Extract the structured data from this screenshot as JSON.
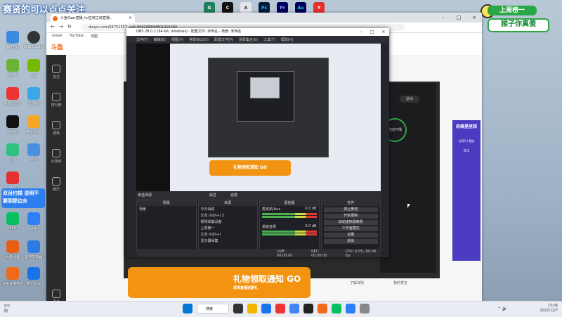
{
  "desktop": {
    "banner_top": "赛贤的可以点点关注",
    "left_badge": "双目扫描 说明不要到那边去",
    "icons": [
      "腾讯QQ",
      "OBS Studio",
      "NVIDIA",
      "火绒",
      "网易云音乐",
      "QQ游戏",
      "QQ音乐",
      "腾讯视频",
      "迅雷",
      "WPS",
      "微信",
      "斗鱼",
      "360",
      "百度网盘",
      "雷神加速器",
      "斗鱼直播伴侣",
      "腾讯会议",
      "QQ浏览器"
    ]
  },
  "corner_badge": {
    "line1": "上周榜一",
    "line2": "猴子你真傻"
  },
  "browser": {
    "tab_title": "斗鱼Ozar直播_lol正统之房直播...",
    "url": "douyu.com/64751357_yuft-906208894801416260",
    "bookmarks": [
      "Gmail",
      "YouTube",
      "地图"
    ],
    "douyu_logo": "斗鱼",
    "leftbar": [
      "关注",
      "排行榜",
      "游戏",
      "云游戏",
      "娱乐",
      "看鱼",
      "更多"
    ],
    "bottom_ad": "礼物领取通知 GO",
    "bottom_ad_sub": "周周直播送豪礼",
    "right_label_1": "我的发言",
    "right_label_2": "了解详情",
    "right_panel_button": "退出",
    "right_panel_circle": "自动开播",
    "side_ad_title": "奇缘星座馆",
    "side_ad_text": "点亮1个星座",
    "side_ad_count": "0/1"
  },
  "obs": {
    "title": "OBS 28.0.2 (64-bit, windows) - 配置文件: 未命名 - 场景: 未命名",
    "menu": [
      "文件(F)",
      "编辑(E)",
      "视图(V)",
      "停靠窗口(D)",
      "配置文件(P)",
      "场景集合(S)",
      "工具(T)",
      "帮助(H)"
    ],
    "source_bar_label": "未选择源",
    "source_bar_props": "属性",
    "source_bar_filter": "滤镜",
    "scenes_title": "场景",
    "scenes": [
      "场景"
    ],
    "sources_title": "来源",
    "sources": [
      "今日战绩",
      "文本 (GDI+) 2",
      "视频采集设备",
      "上周榜一",
      "文本 (GDI+)",
      "显示器采集"
    ],
    "mixer_title": "混音器",
    "mixer": [
      {
        "name": "麦克风/Aux",
        "db": "0.0 dB"
      },
      {
        "name": "桌面音频",
        "db": "0.0 dB"
      }
    ],
    "controls_title": "控件",
    "controls": [
      "停止推流",
      "开始录制",
      "启动虚拟摄像机",
      "工作室模式",
      "设置",
      "退出"
    ],
    "status": {
      "live": "LIVE: 00:00:00",
      "rec": "REC: 00:00:00",
      "cpu": "CPU: 0.0%, 60.00 fps"
    }
  },
  "taskbar": {
    "weather_temp": "9°C",
    "weather_desc": "阴",
    "search": "搜索",
    "time": "13:06",
    "date": "2022/12/7"
  },
  "colors": {
    "obs_bg": "#25262b",
    "douyu_orange": "#f06a1c",
    "ad_orange": "#f29412",
    "accent_green": "#2aa745"
  }
}
